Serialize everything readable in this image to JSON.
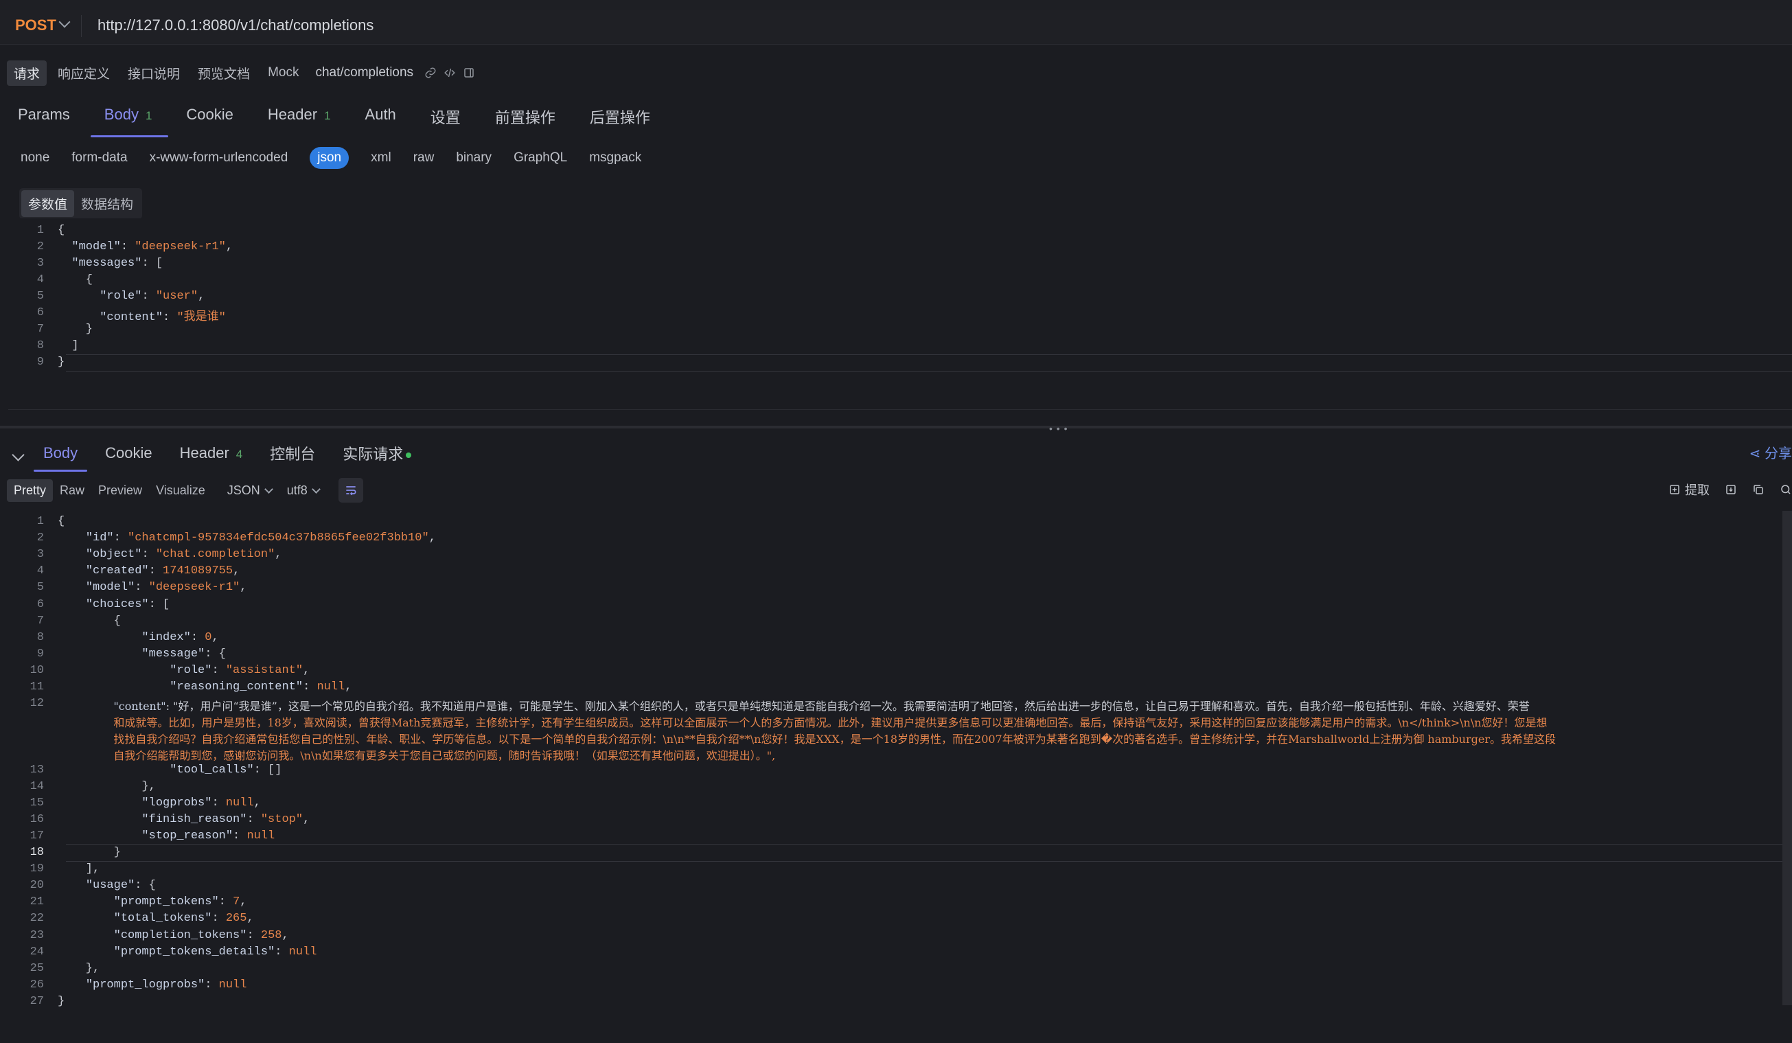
{
  "request": {
    "method": "POST",
    "url": "http://127.0.0.1:8080/v1/chat/completions"
  },
  "subtabs": {
    "items": [
      "请求",
      "响应定义",
      "接口说明",
      "预览文档",
      "Mock"
    ],
    "path": "chat/completions",
    "icons": [
      "link-icon",
      "code-icon",
      "panel-icon"
    ]
  },
  "request_tabs": [
    {
      "label": "Params"
    },
    {
      "label": "Body",
      "badge": "1"
    },
    {
      "label": "Cookie"
    },
    {
      "label": "Header",
      "badge": "1"
    },
    {
      "label": "Auth"
    },
    {
      "label": "设置"
    },
    {
      "label": "前置操作"
    },
    {
      "label": "后置操作"
    }
  ],
  "body_types": [
    "none",
    "form-data",
    "x-www-form-urlencoded",
    "json",
    "xml",
    "raw",
    "binary",
    "GraphQL",
    "msgpack"
  ],
  "param_modes": [
    "参数值",
    "数据结构"
  ],
  "request_body_lines": [
    "{",
    "  \"model\": \"deepseek-r1\",",
    "  \"messages\": [",
    "    {",
    "      \"role\": \"user\",",
    "      \"content\": \"我是谁\"",
    "    }",
    "  ]",
    "}"
  ],
  "response_tabs": [
    {
      "label": "Body"
    },
    {
      "label": "Cookie"
    },
    {
      "label": "Header",
      "badge": "4"
    },
    {
      "label": "控制台"
    },
    {
      "label": "实际请求"
    }
  ],
  "share_label": "分享",
  "response_formats": [
    "Pretty",
    "Raw",
    "Preview",
    "Visualize"
  ],
  "response_type": "JSON",
  "response_encoding": "utf8",
  "extract_label": "提取",
  "colors": {
    "accent": "#6e74e8",
    "string": "#e5854c",
    "method": "#f08a3c",
    "json_pill": "#2f7de1"
  },
  "response_body_lines": [
    "{",
    "    \"id\": \"chatcmpl-957834efdc504c37b8865fee02f3bb10\",",
    "    \"object\": \"chat.completion\",",
    "    \"created\": 1741089755,",
    "    \"model\": \"deepseek-r1\",",
    "    \"choices\": [",
    "        {",
    "            \"index\": 0,",
    "            \"message\": {",
    "                \"role\": \"assistant\",",
    "                \"reasoning_content\": null,",
    "                \"content\": \"好，用户问“我是谁”，这是一个常见的自我介绍。我不知道用户是谁，可能是学生、刚加入某个组织的人，或者只是单纯想知道是否能自我介绍一次。我需要简洁明了地回答，然后给出进一步的信息，让自己易于理解和喜欢。首先，自我介绍一般包括性别、年龄、兴趣爱好、荣誉",
    "                和成就等。比如，用户是男性，18岁，喜欢阅读，曾获得Math竞赛冠军，主修统计学，还有学生组织成员。这样可以全面展示一个人的多方面情况。此外，建议用户提供更多信息可以更准确地回答。最后，保持语气友好，采用这样的回复应该能够满足用户的需求。\\n</think>\\n\\n您好！您是想",
    "                找找自我介绍吗？自我介绍通常包括您自己的性别、年龄、职业、学历等信息。以下是一个简单的自我介绍示例：\\n\\n**自我介绍**\\n您好！我是XXX，是一个18岁的男性，而在2007年被评为某著名跑到�次的著名选手。曾主修统计学，并在Marshallworld上注册为御 hamburger。我希望这段",
    "                自我介绍能帮助到您，感谢您访问我。\\n\\n如果您有更多关于您自己或您的问题，随时告诉我哦！（如果您还有其他问题，欢迎提出）。\",",
    "                \"tool_calls\": []",
    "            },",
    "            \"logprobs\": null,",
    "            \"finish_reason\": \"stop\",",
    "            \"stop_reason\": null",
    "        }",
    "    ],",
    "    \"usage\": {",
    "        \"prompt_tokens\": 7,",
    "        \"total_tokens\": 265,",
    "        \"completion_tokens\": 258,",
    "        \"prompt_tokens_details\": null",
    "    },",
    "    \"prompt_logprobs\": null",
    "}"
  ],
  "response_line_numbers": [
    "1",
    "2",
    "3",
    "4",
    "5",
    "6",
    "7",
    "8",
    "9",
    "10",
    "11",
    "12",
    "",
    "",
    "",
    "13",
    "14",
    "15",
    "16",
    "17",
    "18",
    "19",
    "20",
    "21",
    "22",
    "23",
    "24",
    "25",
    "26",
    "27"
  ]
}
